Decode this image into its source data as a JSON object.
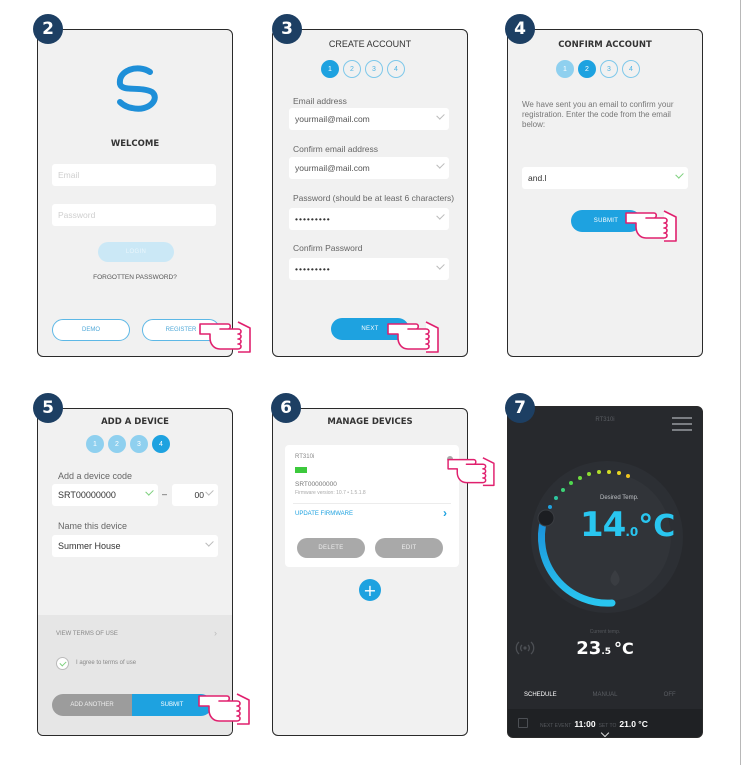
{
  "steps": [
    "2",
    "3",
    "4",
    "5",
    "6",
    "7"
  ],
  "welcome": {
    "title": "WELCOME",
    "email_placeholder": "Email",
    "password_placeholder": "Password",
    "login_label": "LOGIN",
    "forgot_label": "FORGOTTEN PASSWORD?",
    "demo_label": "DEMO",
    "register_label": "REGISTER"
  },
  "create": {
    "title": "CREATE ACCOUNT",
    "steps": [
      "1",
      "2",
      "3",
      "4"
    ],
    "email_label": "Email address",
    "email_value": "yourmail@mail.com",
    "confirm_email_label": "Confirm email address",
    "confirm_email_value": "yourmail@mail.com",
    "password_label": "Password (should be at least 6 characters)",
    "password_value": "•••••••••",
    "confirm_password_label": "Confirm Password",
    "confirm_password_value": "•••••••••",
    "next_label": "NEXT"
  },
  "confirm": {
    "title": "CONFIRM ACCOUNT",
    "steps": [
      "1",
      "2",
      "3",
      "4"
    ],
    "message": "We have sent you an email to confirm your registration. Enter the code from the email below:",
    "code_value": "and.l",
    "submit_label": "SUBMIT"
  },
  "add_device": {
    "title": "ADD A DEVICE",
    "steps": [
      "1",
      "2",
      "3",
      "4"
    ],
    "code_label": "Add a device code",
    "code_value": "SRT00000000",
    "code_dash": "–",
    "code_suffix": "00",
    "name_label": "Name this device",
    "name_value": "Summer House",
    "terms_label": "VIEW TERMS OF USE",
    "agree_label": "I agree to terms of use",
    "add_another_label": "ADD ANOTHER",
    "submit_label": "SUBMIT"
  },
  "manage": {
    "title": "MANAGE DEVICES",
    "device_name": "RT310i",
    "device_serial": "SRT00000000",
    "firmware": "Firmware version: 10.7 • 1.5.1.8",
    "update_label": "UPDATE FIRMWARE",
    "delete_label": "DELETE",
    "edit_label": "EDIT",
    "add_label": "+"
  },
  "thermostat": {
    "device_name": "RT310i",
    "desired_label": "Desired Temp.",
    "temp_main": "14",
    "temp_decimal": ".0",
    "temp_unit": "°C",
    "current_label": "Current temp.",
    "current_main": "23",
    "current_decimal": ".5",
    "current_unit": "°C",
    "tabs": [
      "SCHEDULE",
      "MANUAL",
      "OFF"
    ],
    "next_event_label": "NEXT EVENT",
    "next_event_time": "11:00",
    "set_to_label": "SET TO",
    "set_to_value": "21.0 °C"
  },
  "colors": {
    "step_badge": "#1d3f63",
    "accent_blue": "#1ea2e0",
    "pointer_hand": "#e0206e",
    "dark_panel": "#27292d"
  }
}
